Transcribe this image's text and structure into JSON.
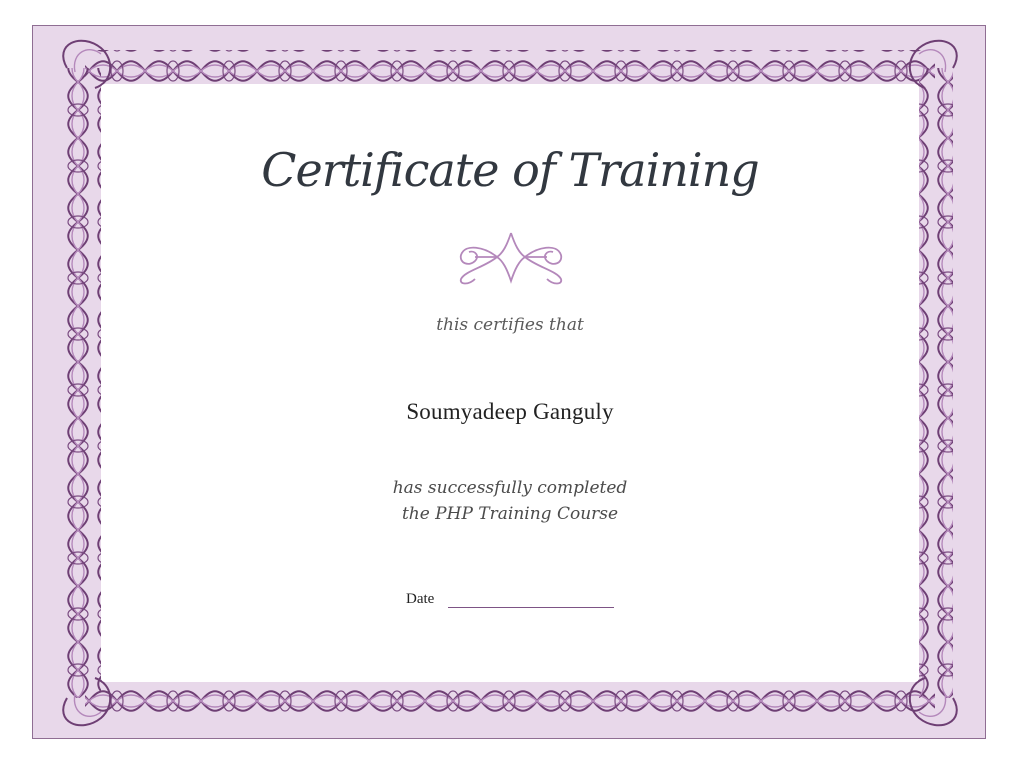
{
  "certificate": {
    "title": "Certificate of Training",
    "subtitle": "this certifies that",
    "recipient": "Soumyadeep Ganguly",
    "completion_line_1": "has successfully completed",
    "completion_line_2": "the PHP Training Course",
    "date_label": "Date"
  },
  "colors": {
    "border_fill": "#e8d8ea",
    "border_stroke": "#8f6e93",
    "ornament_dark": "#6e3f74",
    "ornament_light": "#b488bb",
    "title_text": "#323840"
  },
  "icons": {
    "border": "ornamental-border",
    "flourish": "ornamental-flourish"
  }
}
